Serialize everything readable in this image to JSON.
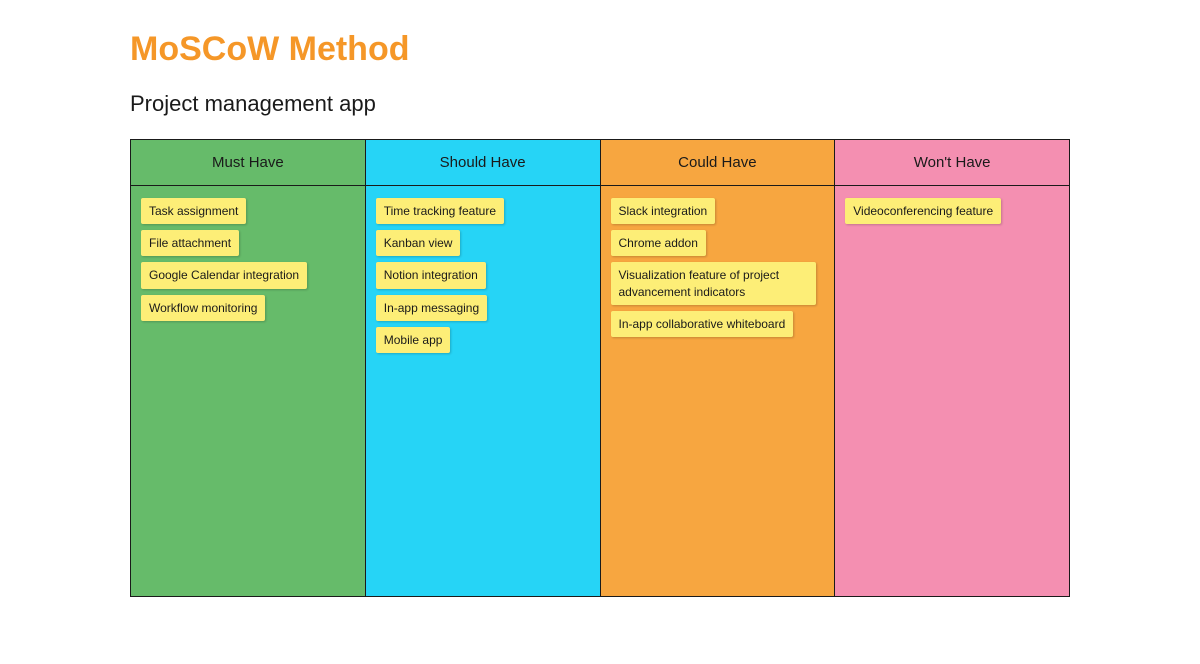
{
  "title": "MoSCoW Method",
  "subtitle": "Project management app",
  "columns": [
    {
      "key": "must",
      "header": "Must Have",
      "notes": [
        "Task assignment",
        "File attachment",
        "Google Calendar integration",
        "Workflow monitoring"
      ]
    },
    {
      "key": "should",
      "header": "Should Have",
      "notes": [
        "Time tracking feature",
        "Kanban view",
        "Notion integration",
        "In-app messaging",
        "Mobile app"
      ]
    },
    {
      "key": "could",
      "header": "Could Have",
      "notes": [
        "Slack integration",
        "Chrome addon",
        "Visualization feature of project advancement indicators",
        "In-app collaborative whiteboard"
      ]
    },
    {
      "key": "wont",
      "header": "Won't Have",
      "notes": [
        "Videoconferencing feature"
      ]
    }
  ],
  "colors": {
    "accent_title": "#f59728",
    "must": "#66bb6a",
    "should": "#26d4f6",
    "could": "#f7a640",
    "wont": "#f48fb1",
    "note_bg": "#fdee77"
  }
}
